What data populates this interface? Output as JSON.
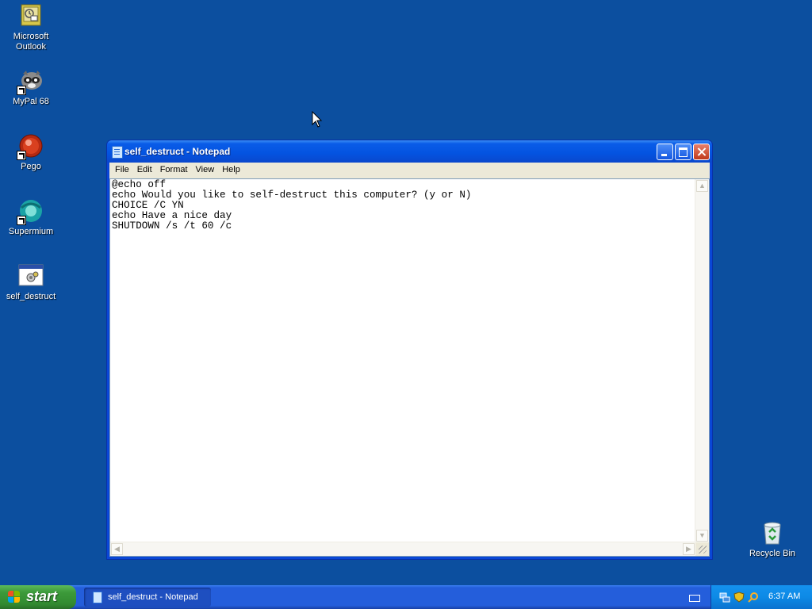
{
  "desktop": {
    "icons": [
      {
        "label": "Microsoft Outlook",
        "icon": "outlook-icon"
      },
      {
        "label": "MyPal 68",
        "icon": "mypal-icon"
      },
      {
        "label": "Pego",
        "icon": "pego-icon"
      },
      {
        "label": "Supermium",
        "icon": "supermium-icon"
      },
      {
        "label": "self_destruct",
        "icon": "batch-file-icon"
      }
    ],
    "recycle_bin": {
      "label": "Recycle Bin",
      "icon": "recycle-bin-icon"
    }
  },
  "window": {
    "title": "self_destruct - Notepad",
    "menu": [
      "File",
      "Edit",
      "Format",
      "View",
      "Help"
    ],
    "content": "@echo off\necho Would you like to self-destruct this computer? (y or N)\nCHOICE /C YN\necho Have a nice day\nSHUTDOWN /s /t 60 /c"
  },
  "taskbar": {
    "start_label": "start",
    "tasks": [
      {
        "label": "self_destruct - Notepad"
      }
    ],
    "clock": "6:37 AM"
  },
  "colors": {
    "desktop": "#0c4f9f",
    "titlebar": "#0453e0",
    "taskbar": "#245edb",
    "start": "#3c9a3a"
  }
}
